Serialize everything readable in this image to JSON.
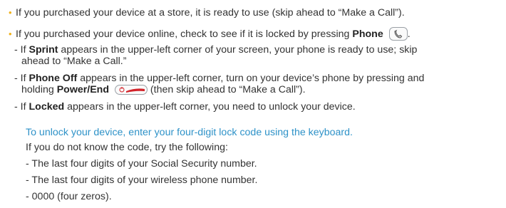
{
  "colors": {
    "accent": "#2e92c8",
    "bullet": "#f0b21b",
    "power_red": "#d2232a"
  },
  "items": [
    {
      "pre": "If you purchased your device at a store, it is ready to use (skip ahead to “Make a Call”)."
    },
    {
      "pre": "If you purchased your device online, check to see if it is locked by pressing ",
      "bold": "Phone",
      "post": "."
    }
  ],
  "sub_items": {
    "sprint": {
      "pre": "- If ",
      "bold": "Sprint",
      "post1": " appears in the upper-left corner of your screen, your phone is ready to use; skip",
      "post2": "ahead to “Make a Call.”"
    },
    "phone_off": {
      "pre": "- If ",
      "bold": "Phone Off",
      "post1": " appears in the upper-left corner, turn on your device’s phone by pressing and",
      "line2_pre": "holding ",
      "line2_bold": "Power/End",
      "line2_post": " (then skip ahead to “Make a Call”)."
    },
    "locked": {
      "pre": "- If ",
      "bold": "Locked",
      "post": " appears in the upper-left corner, you need to unlock your device."
    }
  },
  "unlock": {
    "heading": "To unlock your device, enter your four-digit lock code using the keyboard.",
    "intro": "If you do not know the code, try the following:",
    "options": [
      "- The last four digits of your Social Security number.",
      "- The last four digits of your wireless phone number.",
      "- 0000 (four zeros)."
    ]
  }
}
